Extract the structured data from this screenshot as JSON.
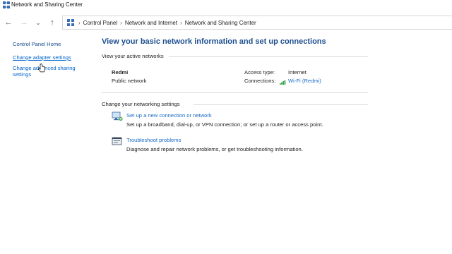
{
  "window": {
    "title": "Network and Sharing Center"
  },
  "nav": {
    "back": "←",
    "forward": "→",
    "recent": "⌄",
    "up": "↑",
    "separator": "›",
    "breadcrumbs": [
      "Control Panel",
      "Network and Internet",
      "Network and Sharing Center"
    ]
  },
  "left": {
    "home": "Control Panel Home",
    "links": [
      "Change adapter settings",
      "Change advanced sharing settings"
    ]
  },
  "main": {
    "title": "View your basic network information and set up connections",
    "active_networks_label": "View your active networks",
    "network": {
      "name": "Redmi",
      "type": "Public network",
      "access_type_label": "Access type:",
      "access_type_value": "Internet",
      "connections_label": "Connections:",
      "connections_value": "Wi-Fi (Redmi)"
    },
    "settings_label": "Change your networking settings",
    "tasks": [
      {
        "icon": "new-connection-icon",
        "link": "Set up a new connection or network",
        "desc": "Set up a broadband, dial-up, or VPN connection; or set up a router or access point."
      },
      {
        "icon": "troubleshoot-icon",
        "link": "Troubleshoot problems",
        "desc": "Diagnose and repair network problems, or get troubleshooting information."
      }
    ]
  },
  "colors": {
    "link": "#1a6bc4",
    "title": "#1c4e8f",
    "wifi": "#2e9e3e"
  }
}
